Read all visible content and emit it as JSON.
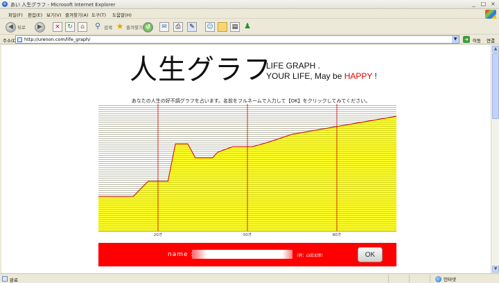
{
  "window": {
    "title": "あい 人生グラフ - Microsoft Internet Explorer",
    "controls": [
      "_",
      "□",
      "×"
    ]
  },
  "menu": [
    "파일(F)",
    "편집(E)",
    "보기(V)",
    "즐겨찾기(A)",
    "도구(T)",
    "도움말(H)"
  ],
  "toolbar": {
    "back_label": "뒤로",
    "search_label": "검색",
    "favorites_label": "즐겨찾기"
  },
  "address": {
    "label": "주소(D)",
    "url": "http://urenon.com/life_graph/",
    "go_label": "이동",
    "links_label": "연결"
  },
  "status": {
    "text": "완료",
    "zone": "인터넷"
  },
  "page": {
    "title": "人生グラフ",
    "subtitle_line1": "LIFE GRAPH .",
    "subtitle_line2_prefix": "YOUR LIFE, May be ",
    "subtitle_line2_highlight": "HAPPY",
    "subtitle_line2_suffix": " !",
    "instruction": "あなたの人生の好不調グラフを占います。名前をフルネームで入力して【OK】をクリックしてみてください。",
    "form": {
      "name_label": "name :",
      "name_value": "",
      "hint": "（例：山田太郎）",
      "ok_label": "OK"
    }
  },
  "colors": {
    "accent_red": "#ff0000",
    "fill_yellow": "#ffff00",
    "happy_red": "#e10000"
  },
  "chart_data": {
    "type": "area",
    "x": [
      0,
      7,
      10,
      14,
      15.5,
      18,
      19.5,
      23,
      24,
      27,
      31,
      34,
      39,
      60
    ],
    "y": [
      17,
      17,
      28,
      28,
      55,
      55,
      45,
      45,
      49,
      53,
      53,
      56,
      62,
      75
    ],
    "xlim": [
      0,
      60
    ],
    "ylim": [
      -8,
      84
    ],
    "xtick_values": [
      12,
      30,
      48
    ],
    "xtick_labels": [
      "20才",
      "50才",
      "80才"
    ],
    "grid": true
  }
}
